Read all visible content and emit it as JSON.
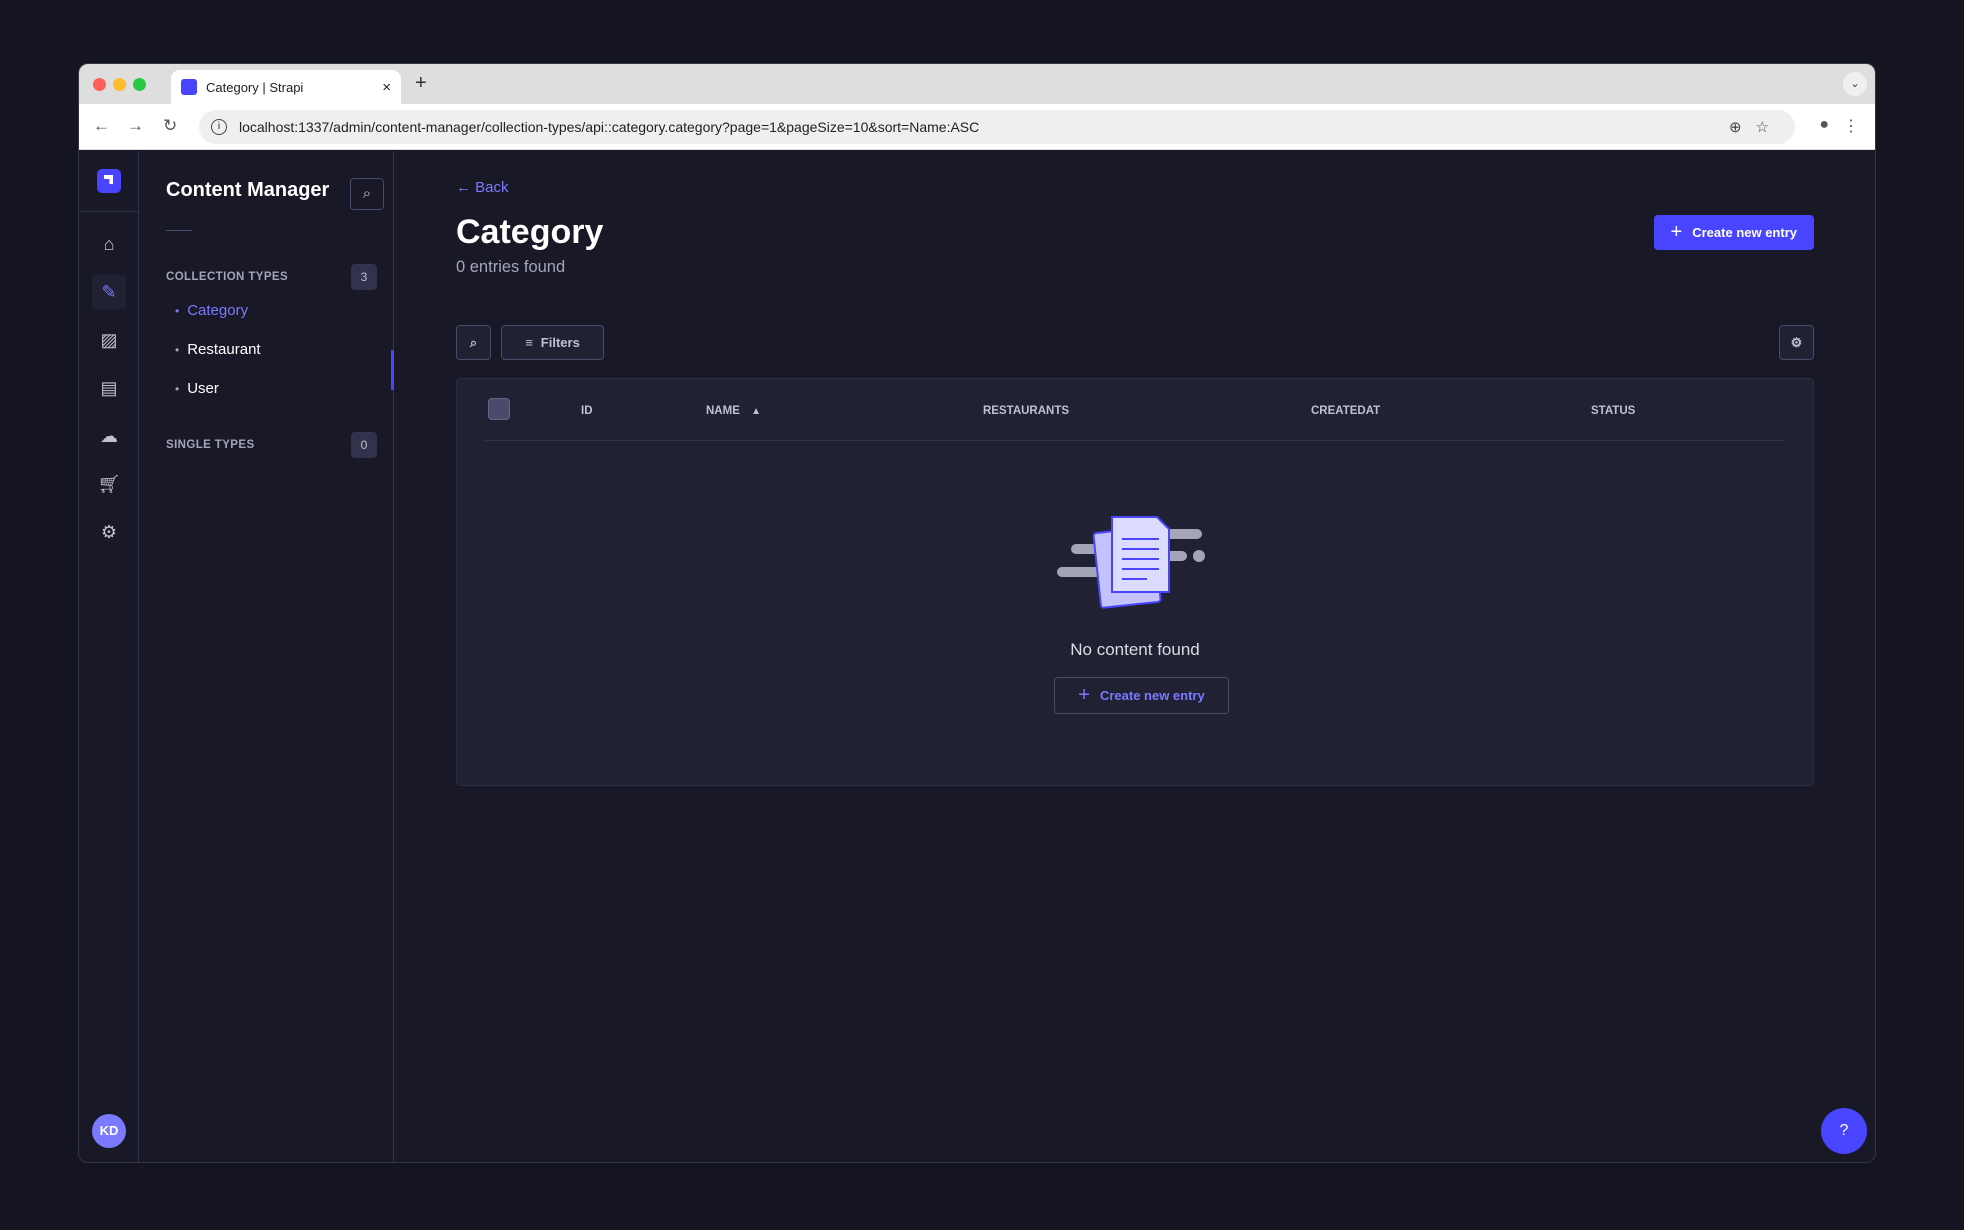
{
  "browser": {
    "tab_title": "Category | Strapi",
    "tab_close": "×",
    "new_tab": "+",
    "url": "localhost:1337/admin/content-manager/collection-types/api::category.category?page=1&pageSize=10&sort=Name:ASC",
    "tab_menu": "⌄"
  },
  "rail": {
    "avatar_initials": "KD",
    "items": [
      "home",
      "content-manager",
      "media-library",
      "content-type-builder",
      "cloud",
      "marketplace",
      "settings"
    ]
  },
  "sidebar": {
    "title": "Content Manager",
    "collection_types_label": "COLLECTION TYPES",
    "collection_types_count": "3",
    "collection_items": [
      {
        "label": "Category",
        "active": true
      },
      {
        "label": "Restaurant"
      },
      {
        "label": "User"
      }
    ],
    "single_types_label": "SINGLE TYPES",
    "single_types_count": "0"
  },
  "main": {
    "back_label": "Back",
    "title": "Category",
    "entries_count": "0 entries found",
    "create_label": "Create new entry",
    "filters_label": "Filters",
    "table": {
      "columns": [
        "ID",
        "NAME",
        "RESTAURANTS",
        "CREATEDAT",
        "STATUS"
      ],
      "sorted_column": "NAME",
      "sort_direction": "asc",
      "empty_text": "No content found",
      "empty_create_label": "Create new entry"
    }
  },
  "colors": {
    "primary": "#4945ff",
    "link": "#7b79ff",
    "background": "#181826",
    "surface": "#212134"
  }
}
